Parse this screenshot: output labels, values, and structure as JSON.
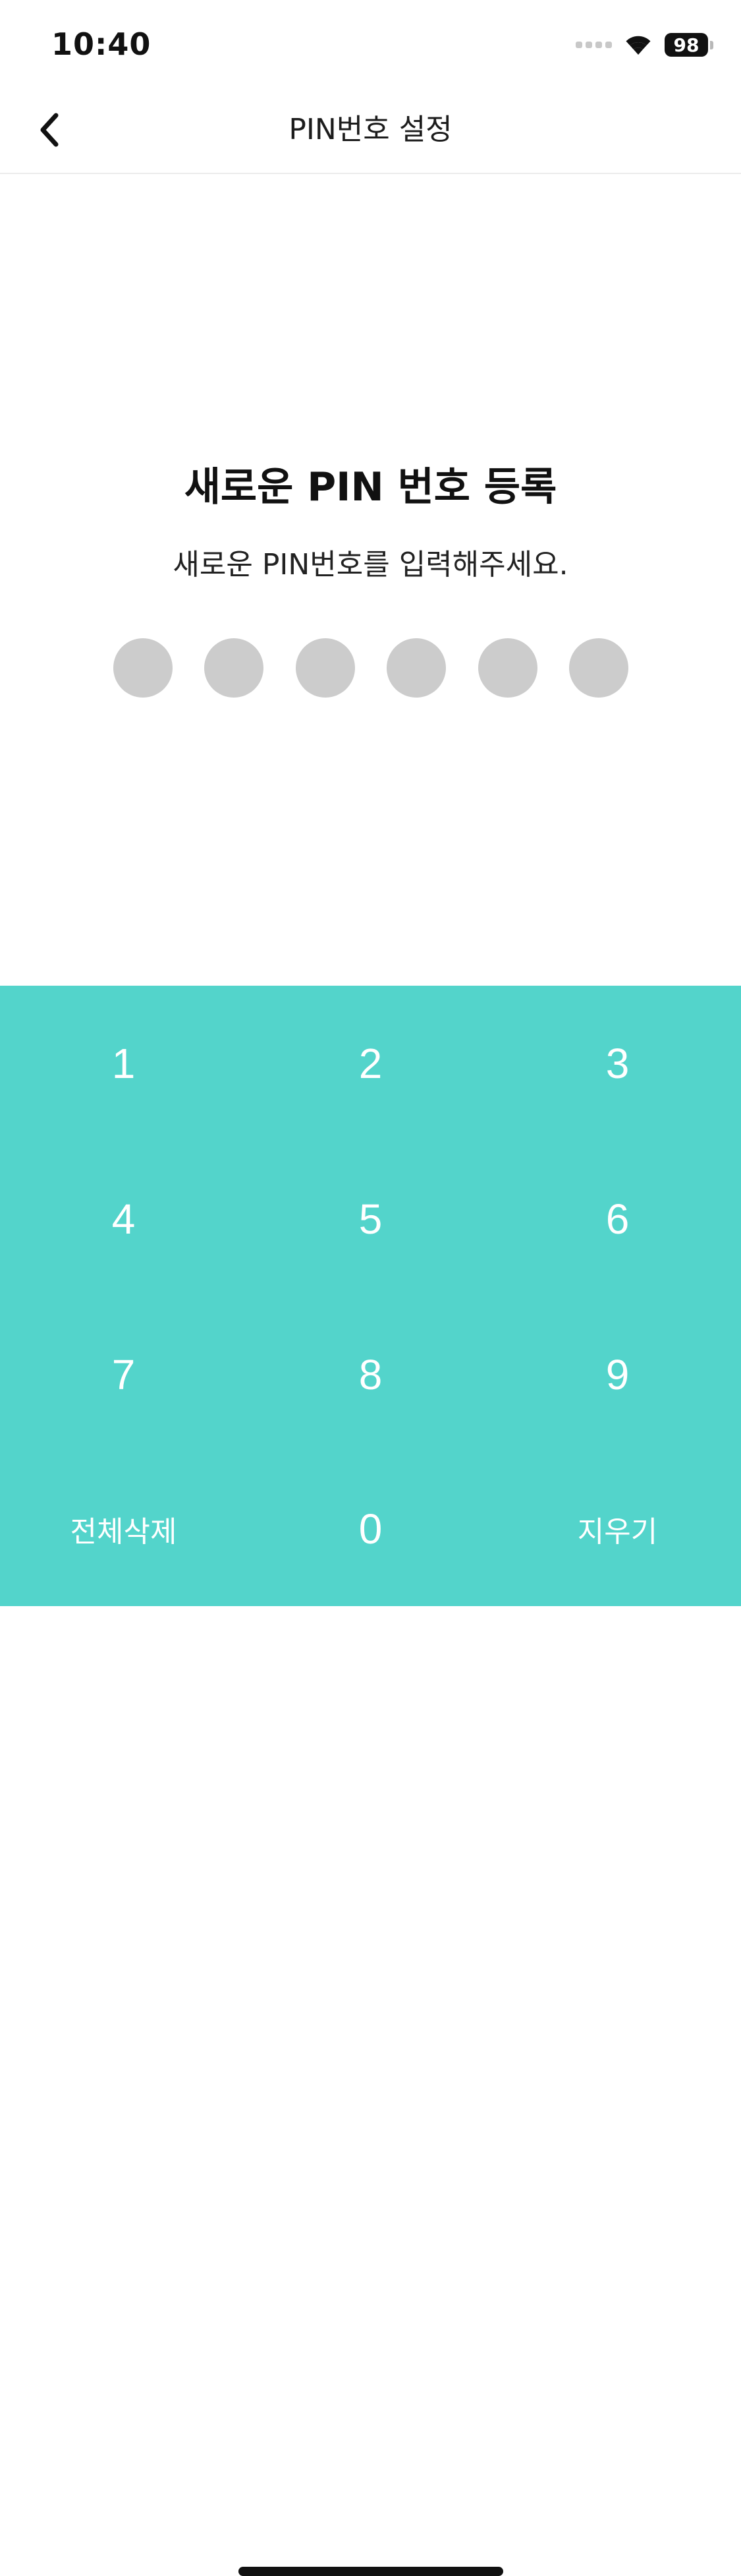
{
  "status_bar": {
    "time": "10:40",
    "battery": "98"
  },
  "nav": {
    "title": "PIN번호 설정"
  },
  "content": {
    "headline": "새로운 PIN 번호 등록",
    "subtext": "새로운 PIN번호를 입력해주세요.",
    "pin_length": 6
  },
  "keypad": {
    "keys": [
      "1",
      "2",
      "3",
      "4",
      "5",
      "6",
      "7",
      "8",
      "9",
      "전체삭제",
      "0",
      "지우기"
    ]
  },
  "colors": {
    "keypad_bg": "#53d4cb",
    "pin_dot_empty": "#cccccc"
  },
  "icons": {
    "back": "chevron-left-icon",
    "wifi": "wifi-icon",
    "signal": "cellular-signal-icon",
    "battery": "battery-icon"
  }
}
